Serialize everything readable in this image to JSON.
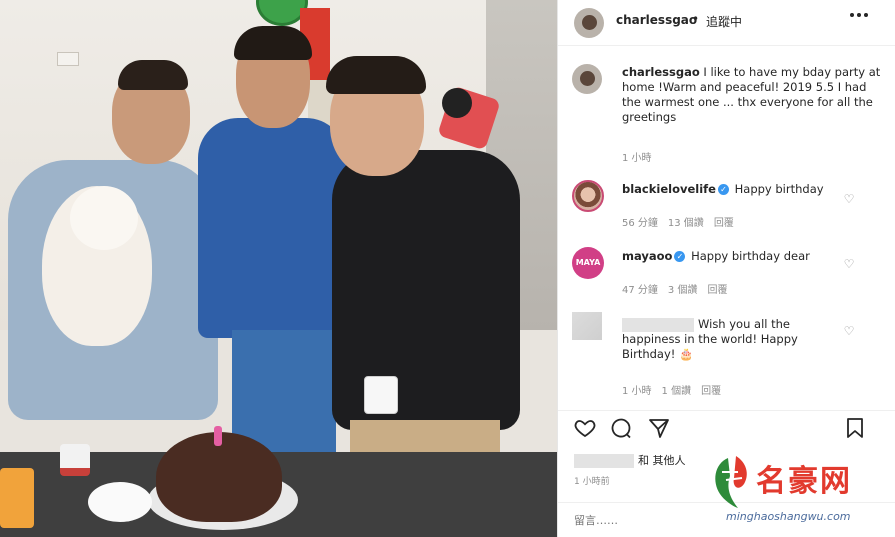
{
  "header": {
    "username": "charlessgao",
    "separator": "•",
    "follow_status": "追蹤中",
    "more_icon": "more-dots-icon"
  },
  "caption": {
    "username": "charlessgao",
    "text": " I like to have my bday party at home !Warm and peaceful! 2019 5.5 I had the warmest one ... thx everyone for all the greetings",
    "time": "1 小時"
  },
  "comments": [
    {
      "username": "blackielovelife",
      "verified": true,
      "text": "Happy birthday",
      "time": "56 分鐘",
      "likes": "13 個讚",
      "reply": "回覆"
    },
    {
      "username": "mayaoo",
      "verified": true,
      "text": "Happy birthday dear",
      "time": "47 分鐘",
      "likes": "3 個讚",
      "reply": "回覆"
    },
    {
      "text": "Wish you all the happiness in the world! Happy Birthday! 🎂",
      "time": "1 小時",
      "likes": "1 個讚",
      "reply": "回覆"
    }
  ],
  "actions": {
    "like_icon": "heart-icon",
    "comment_icon": "comment-icon",
    "share_icon": "share-icon",
    "save_icon": "bookmark-icon"
  },
  "likes_text": "和 其他人",
  "post_time": "1 小時前",
  "add_comment_placeholder": "留言……",
  "watermark": {
    "title": "名豪网",
    "url": "minghaoshangwu.com"
  },
  "colors": {
    "verified": "#3897f0",
    "watermark_red": "#e23a2e",
    "muted": "#8e8e8e"
  }
}
